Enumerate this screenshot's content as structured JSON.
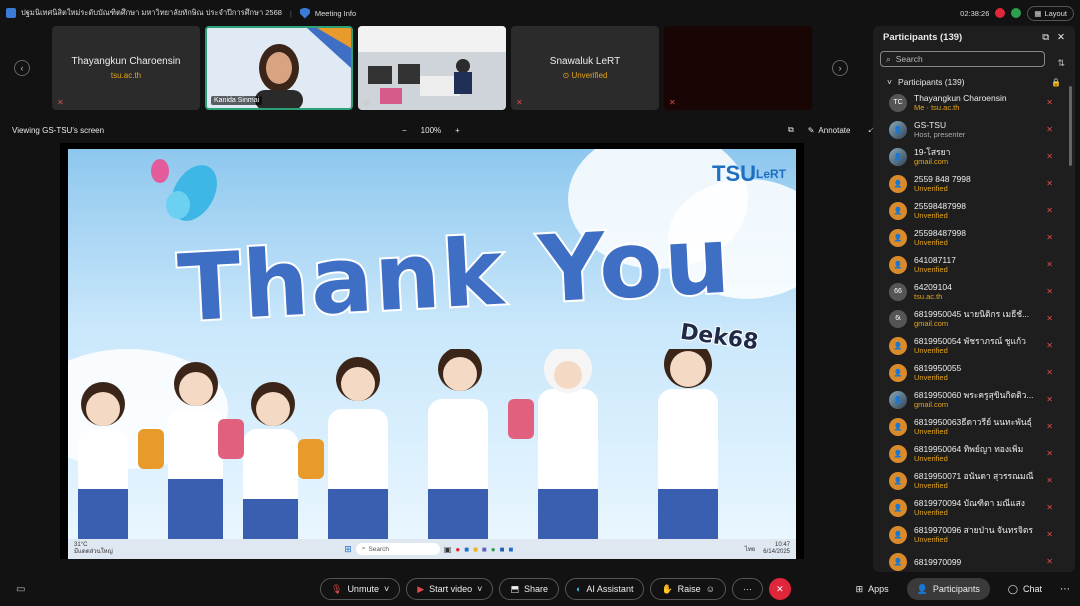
{
  "topbar": {
    "meeting_title": "ปฐมนิเทศนิสิตใหม่ระดับบัณฑิตศึกษา มหาวิทยาลัยทักษิณ ประจำปีการศึกษา 2568",
    "meeting_info": "Meeting Info",
    "time": "02:38:26",
    "layout_label": "Layout"
  },
  "tiles": [
    {
      "name": "Thayangkun Charoensin",
      "sub": "tsu.ac.th"
    },
    {
      "name": "Kanida Sinmai",
      "sub": ""
    },
    {
      "name": "",
      "sub": ""
    },
    {
      "name": "Snawaluk LeRT",
      "sub": "Unverified"
    },
    {
      "name": "",
      "sub": ""
    }
  ],
  "viewbar": {
    "viewing": "Viewing GS-TSU's screen",
    "zoom": "100%",
    "annotate": "Annotate"
  },
  "slide": {
    "headline": "Thank You",
    "tag": "Dek68",
    "logo_text": "TSU",
    "logo2": "LeRT"
  },
  "taskbar": {
    "weather": "31°C",
    "weather_sub": "มีแดดส่วนใหญ่",
    "search": "Search",
    "lang": "ไทย",
    "time": "10:47",
    "date": "6/14/2025"
  },
  "controls": {
    "unmute": "Unmute",
    "start_video": "Start video",
    "share": "Share",
    "ai": "AI Assistant",
    "raise": "Raise",
    "more": "···",
    "apps": "Apps",
    "participants": "Participants",
    "chat": "Chat"
  },
  "panel": {
    "title": "Participants (139)",
    "search_placeholder": "Search",
    "group": "Participants (139)",
    "items": [
      {
        "initials": "TC",
        "name": "Thayangkun Charoensin",
        "sub": "Me · tsu.ac.th",
        "gray": true
      },
      {
        "initials": "",
        "name": "GS-TSU",
        "sub": "Host, presenter",
        "gray": true
      },
      {
        "initials": "",
        "name": "19-โสรยา",
        "sub": "gmail.com",
        "gray": false
      },
      {
        "initials": "",
        "name": "2559 848 7998",
        "sub": "Unverified",
        "gray": false
      },
      {
        "initials": "",
        "name": "25598487998",
        "sub": "Unverified",
        "gray": false
      },
      {
        "initials": "",
        "name": "25598487998",
        "sub": "Unverified",
        "gray": false
      },
      {
        "initials": "",
        "name": "641087117",
        "sub": "Unverified",
        "gray": false
      },
      {
        "initials": "66",
        "name": "64209104",
        "sub": "tsu.ac.th",
        "gray": false
      },
      {
        "initials": "6ɩ",
        "name": "6819950045 นายนิติกร เมธีชั...",
        "sub": "gmail.com",
        "gray": false
      },
      {
        "initials": "",
        "name": "6819950054 พัชราภรณ์ ชูแก้ว",
        "sub": "Unverified",
        "gray": false
      },
      {
        "initials": "",
        "name": "6819950055",
        "sub": "Unverified",
        "gray": false
      },
      {
        "initials": "",
        "name": "6819950060 พระครูสุขินกิตติว...",
        "sub": "gmail.com",
        "gray": false
      },
      {
        "initials": "",
        "name": "6819950063ธีดาวรีย์ นนทะพันธุ์",
        "sub": "Unverified",
        "gray": false
      },
      {
        "initials": "",
        "name": "6819950064 ทิพย์ญา ทองเพิ่ม",
        "sub": "Unverified",
        "gray": false
      },
      {
        "initials": "",
        "name": "6819950071 อนันดา สุวรรณมณี",
        "sub": "Unverified",
        "gray": false
      },
      {
        "initials": "",
        "name": "6819970094 บัณฑิตา มณีแสง",
        "sub": "Unverified",
        "gray": false
      },
      {
        "initials": "",
        "name": "6819970096 สายป่าน จันทรจิตร",
        "sub": "Unverified",
        "gray": false
      },
      {
        "initials": "",
        "name": "6819970099",
        "sub": "",
        "gray": false
      }
    ]
  }
}
